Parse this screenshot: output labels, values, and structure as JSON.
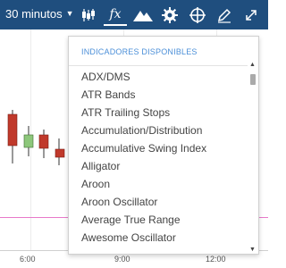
{
  "toolbar": {
    "interval_label": "30 minutos",
    "tools": [
      {
        "icon": "candlestick-chart-icon"
      },
      {
        "icon": "function-icon",
        "label": "fx",
        "active": true
      },
      {
        "icon": "mountain-icon"
      },
      {
        "icon": "gear-icon"
      },
      {
        "icon": "crosshair-icon"
      },
      {
        "icon": "pencil-icon"
      },
      {
        "icon": "expand-icon"
      }
    ]
  },
  "indicators_panel": {
    "header": "INDICADORES DISPONIBLES",
    "items": [
      "ADX/DMS",
      "ATR Bands",
      "ATR Trailing Stops",
      "Accumulation/Distribution",
      "Accumulative Swing Index",
      "Alligator",
      "Aroon",
      "Aroon Oscillator",
      "Average True Range",
      "Awesome Oscillator"
    ]
  },
  "chart": {
    "x_ticks": [
      "6:00",
      "9:00",
      "12:00"
    ],
    "colors": {
      "up": "#8dc77b",
      "down": "#c0392b",
      "line": "#e879c9"
    }
  }
}
